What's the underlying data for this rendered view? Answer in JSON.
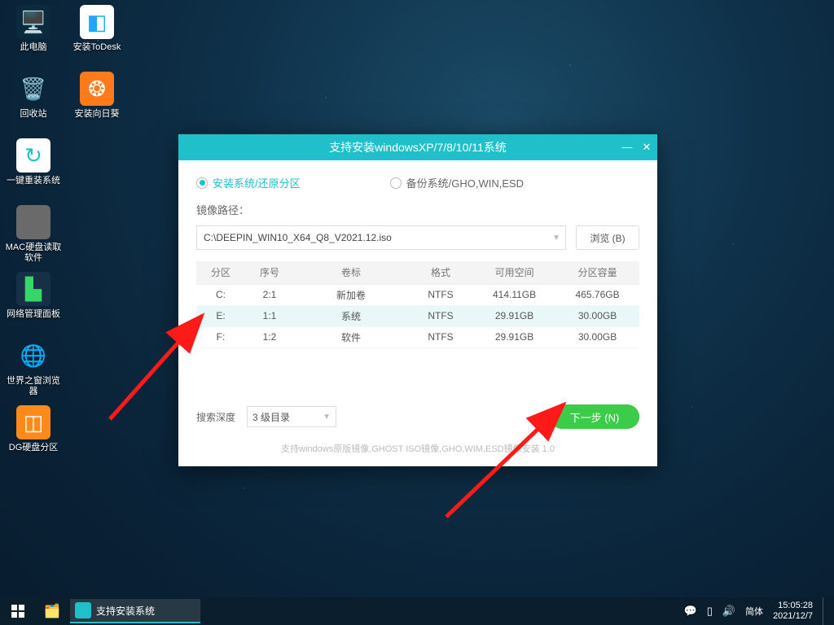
{
  "desktop": [
    {
      "name": "此电脑",
      "bg": "#0b2a3d",
      "fg": "#7bd6e6",
      "glyph": "🖥️"
    },
    {
      "name": "安装ToDesk",
      "bg": "#ffffff",
      "fg": "#1fa7ff",
      "glyph": "◧"
    },
    {
      "name": "回收站",
      "bg": "transparent",
      "fg": "#cfe",
      "glyph": "🗑️"
    },
    {
      "name": "安装向日葵",
      "bg": "#ff7a1a",
      "fg": "#fff",
      "glyph": "❂"
    },
    {
      "name": "一键重装系统",
      "bg": "#ffffff",
      "fg": "#1fc0c9",
      "glyph": "↻"
    },
    {
      "name": "MAC硬盘读取软件",
      "bg": "#6a6a6a",
      "fg": "#d6d6d6",
      "glyph": ""
    },
    {
      "name": "网络管理面板",
      "bg": "#173047",
      "fg": "#37d66b",
      "glyph": "▙"
    },
    {
      "name": "世界之窗浏览器",
      "bg": "transparent",
      "fg": "#bde",
      "glyph": "🌐"
    },
    {
      "name": "DG硬盘分区",
      "bg": "#ff8a1a",
      "fg": "#fff",
      "glyph": "◫"
    }
  ],
  "installer": {
    "title": "支持安装windowsXP/7/8/10/11系统",
    "tab_install": "安装系统/还原分区",
    "tab_backup": "备份系统/GHO,WIN,ESD",
    "path_label": "镜像路径：",
    "path_value": "C:\\DEEPIN_WIN10_X64_Q8_V2021.12.iso",
    "browse": "浏览 (B)",
    "headers": [
      "分区",
      "序号",
      "卷标",
      "格式",
      "可用空间",
      "分区容量"
    ],
    "rows": [
      {
        "drive": "C:",
        "seq": "2:1",
        "label": "新加卷",
        "fs": "NTFS",
        "free": "414.11GB",
        "total": "465.76GB",
        "sel": false
      },
      {
        "drive": "E:",
        "seq": "1:1",
        "label": "系统",
        "fs": "NTFS",
        "free": "29.91GB",
        "total": "30.00GB",
        "sel": true
      },
      {
        "drive": "F:",
        "seq": "1:2",
        "label": "软件",
        "fs": "NTFS",
        "free": "29.91GB",
        "total": "30.00GB",
        "sel": false
      }
    ],
    "search_depth_label": "搜索深度",
    "search_depth_value": "3 级目录",
    "next": "下一步 (N)",
    "support": "支持windows原版镜像,GHOST ISO镜像,GHO,WIM,ESD镜像安装     1.0"
  },
  "taskbar": {
    "task_label": "支持安装系统",
    "ime": "简体",
    "time": "15:05:28",
    "date": "2021/12/7"
  }
}
